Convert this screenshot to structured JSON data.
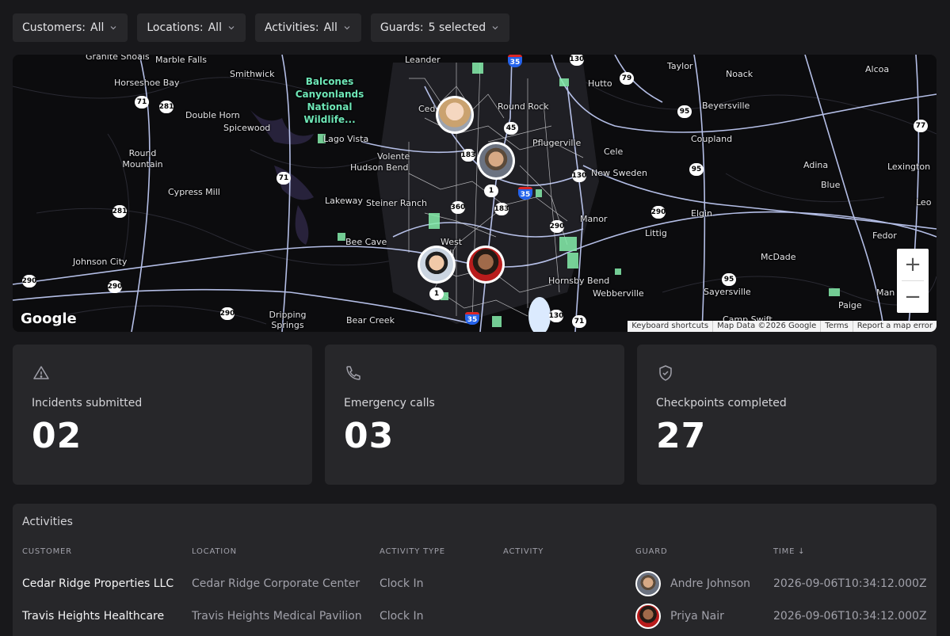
{
  "filters": [
    {
      "key": "Customers:",
      "value": "All"
    },
    {
      "key": "Locations:",
      "value": "All"
    },
    {
      "key": "Activities:",
      "value": "All"
    },
    {
      "key": "Guards:",
      "value": "5 selected"
    }
  ],
  "map": {
    "labels": {
      "granite_shoals": "Granite Shoals",
      "marble_falls": "Marble Falls",
      "horseshoe_bay": "Horseshoe Bay",
      "smithwick": "Smithwick",
      "double_horn": "Double Horn",
      "spicewood": "Spicewood",
      "round_mountain": "Round Mountain",
      "cypress_mill": "Cypress Mill",
      "johnson_city": "Johnson City",
      "lago_vista": "Lago Vista",
      "volente": "Volente",
      "hudson_bend": "Hudson Bend",
      "lakeway": "Lakeway",
      "steiner_ranch": "Steiner Ranch",
      "bee_cave": "Bee Cave",
      "west_hill": "West Hill",
      "dripping_springs": "Dripping Springs",
      "bear_creek": "Bear Creek",
      "leander": "Leander",
      "cedar_park": "Ced",
      "round_rock": "Round Rock",
      "hutto": "Hutto",
      "pflugerville": "Pflugerville",
      "cele": "Cele",
      "new_sweden": "New Sweden",
      "manor": "Manor",
      "littig": "Littig",
      "elgin": "Elgin",
      "hornsby_bend": "Hornsby Bend",
      "webberville": "Webberville",
      "taylor": "Taylor",
      "noack": "Noack",
      "alcoa": "Alcoa",
      "beyersville": "Beyersville",
      "coupland": "Coupland",
      "adina": "Adina",
      "blue": "Blue",
      "lexington": "Lexington",
      "leo": "Leo",
      "fedor": "Fedor",
      "mcdade": "McDade",
      "sayersville": "Sayersville",
      "paige": "Paige",
      "man": "Man",
      "camp_swift": "Camp Swift",
      "park": "Balcones Canyonlands National Wildlife..."
    },
    "shields": [
      "71",
      "281",
      "71",
      "281",
      "290",
      "290",
      "290",
      "360",
      "183",
      "183",
      "1",
      "1",
      "35",
      "35",
      "35",
      "130",
      "130",
      "130",
      "45",
      "290",
      "290",
      "95",
      "95",
      "95",
      "79",
      "77",
      "71"
    ],
    "google_logo": "Google",
    "attribution": [
      "Keyboard shortcuts",
      "Map Data ©2026 Google",
      "Terms",
      "Report a map error"
    ],
    "zoom_in": "+",
    "zoom_out": "−"
  },
  "stats": [
    {
      "label": "Incidents submitted",
      "value": "02",
      "icon": "alert-triangle-icon"
    },
    {
      "label": "Emergency calls",
      "value": "03",
      "icon": "phone-icon"
    },
    {
      "label": "Checkpoints completed",
      "value": "27",
      "icon": "shield-check-icon"
    }
  ],
  "activities": {
    "title": "Activities",
    "columns": [
      "CUSTOMER",
      "LOCATION",
      "ACTIVITY TYPE",
      "ACTIVITY",
      "GUARD",
      "TIME ↓"
    ],
    "rows": [
      {
        "customer": "Cedar Ridge Properties LLC",
        "location": "Cedar Ridge Corporate Center",
        "type": "Clock In",
        "activity": "",
        "guard": "Andre Johnson",
        "time": "2026-09-06T10:34:12.000Z"
      },
      {
        "customer": "Travis Heights Healthcare",
        "location": "Travis Heights Medical Pavilion",
        "type": "Clock In",
        "activity": "",
        "guard": "Priya Nair",
        "time": "2026-09-06T10:34:12.000Z"
      }
    ]
  },
  "colors": {
    "background": "#18181b",
    "panel": "#27272a",
    "map_bg": "#0c0c0e",
    "road": "#c7d2fe",
    "park": "#86efac"
  }
}
